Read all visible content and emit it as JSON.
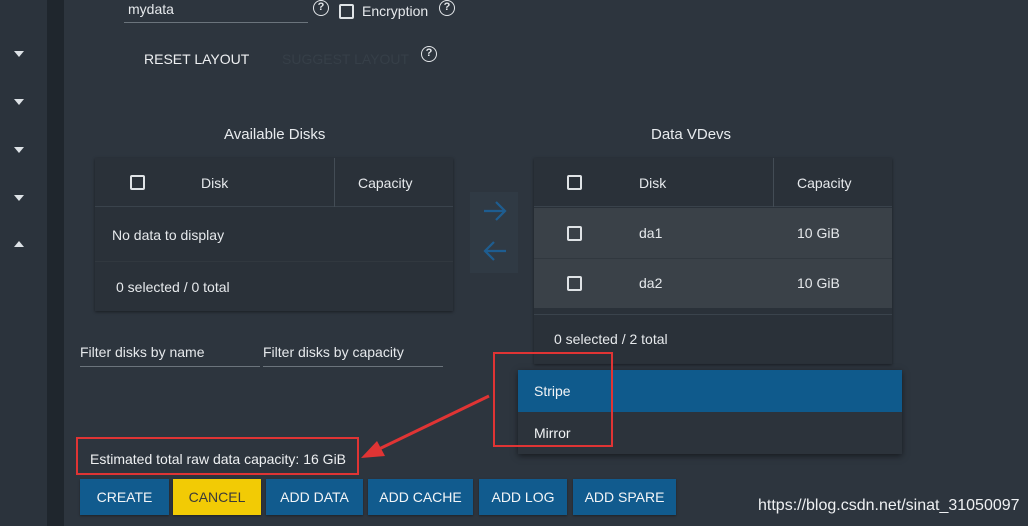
{
  "form": {
    "pool_name_value": "mydata",
    "encryption_label": "Encryption",
    "help_glyph": "?",
    "reset_layout_label": "RESET LAYOUT",
    "suggest_layout_label": "SUGGEST LAYOUT"
  },
  "available_disks": {
    "title": "Available Disks",
    "columns": [
      "Disk",
      "Capacity"
    ],
    "empty_message": "No data to display",
    "footer": "0 selected / 0 total"
  },
  "data_vdevs": {
    "title": "Data VDevs",
    "columns": [
      "Disk",
      "Capacity"
    ],
    "rows": [
      {
        "disk": "da1",
        "capacity": "10 GiB"
      },
      {
        "disk": "da2",
        "capacity": "10 GiB"
      }
    ],
    "footer": "0 selected / 2 total"
  },
  "filters": {
    "by_name": "Filter disks by name",
    "by_capacity": "Filter disks by capacity"
  },
  "layout_dropdown": {
    "options": [
      "Stripe",
      "Mirror"
    ],
    "selected": "Stripe"
  },
  "estimated_capacity": "Estimated total raw data capacity: 16 GiB",
  "buttons": {
    "create": "CREATE",
    "cancel": "CANCEL",
    "add_data": "ADD DATA",
    "add_cache": "ADD CACHE",
    "add_log": "ADD LOG",
    "add_spare": "ADD SPARE"
  },
  "watermark": "https://blog.csdn.net/sinat_31050097",
  "colors": {
    "background": "#232b33",
    "panel": "#2d353e",
    "primary_button": "#115b8e",
    "cancel_button": "#f2cb05",
    "selected_option": "#0f5a8c",
    "annotation_red": "#e03434"
  },
  "icons": {
    "sidebar": [
      "chevron-down-icon",
      "chevron-down-icon",
      "chevron-down-icon",
      "chevron-down-icon",
      "chevron-up-icon"
    ],
    "move_right": "arrow-right-icon",
    "move_left": "arrow-left-icon",
    "help": "help-circle-icon"
  }
}
